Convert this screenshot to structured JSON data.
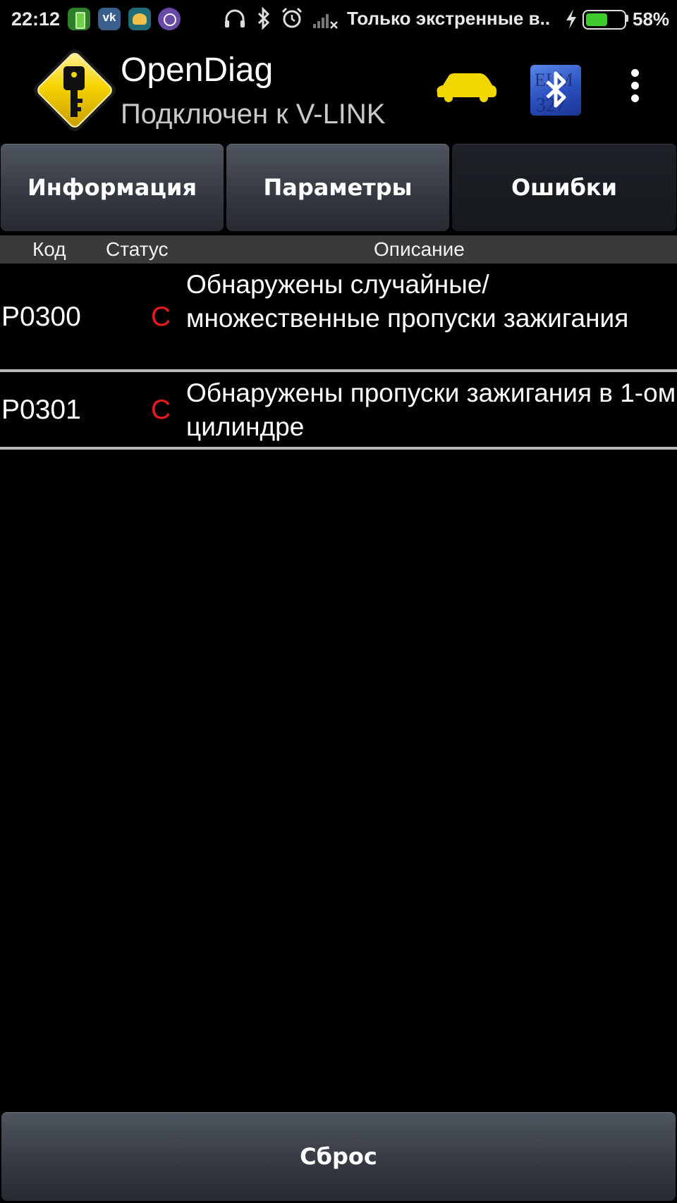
{
  "status_bar": {
    "time": "22:12",
    "notice": "Только экстренные в..",
    "battery_percent_label": "58%",
    "battery_level": 0.58,
    "icons": [
      "battery-app-icon",
      "vk-icon",
      "photo-app-icon",
      "viber-icon",
      "headphones-icon",
      "bluetooth-icon",
      "alarm-icon",
      "no-signal-icon",
      "charging-icon"
    ]
  },
  "action_bar": {
    "title": "OpenDiag",
    "subtitle": "Подключен к V-LINK",
    "icons": [
      "app-logo-key-icon",
      "car-icon",
      "bluetooth-elm327-icon",
      "overflow-menu-icon"
    ]
  },
  "tabs": [
    {
      "label": "Информация",
      "active": false
    },
    {
      "label": "Параметры",
      "active": false
    },
    {
      "label": "Ошибки",
      "active": true
    }
  ],
  "table": {
    "headers": {
      "code": "Код",
      "status": "Статус",
      "description": "Описание"
    },
    "rows": [
      {
        "code": "P0300",
        "status": "C",
        "description": "Обнаружены случайные/ множественные пропуски зажигания"
      },
      {
        "code": "P0301",
        "status": "C",
        "description": "Обнаружены пропуски зажигания в 1-ом цилиндре"
      }
    ]
  },
  "reset_button": {
    "label": "Сброс"
  },
  "colors": {
    "status_error": "#e8181c",
    "battery": "#3ecb2d",
    "logo_yellow": "#f5d400",
    "car": "#f2d600",
    "bluetooth_bg": "#2a4fbf"
  }
}
